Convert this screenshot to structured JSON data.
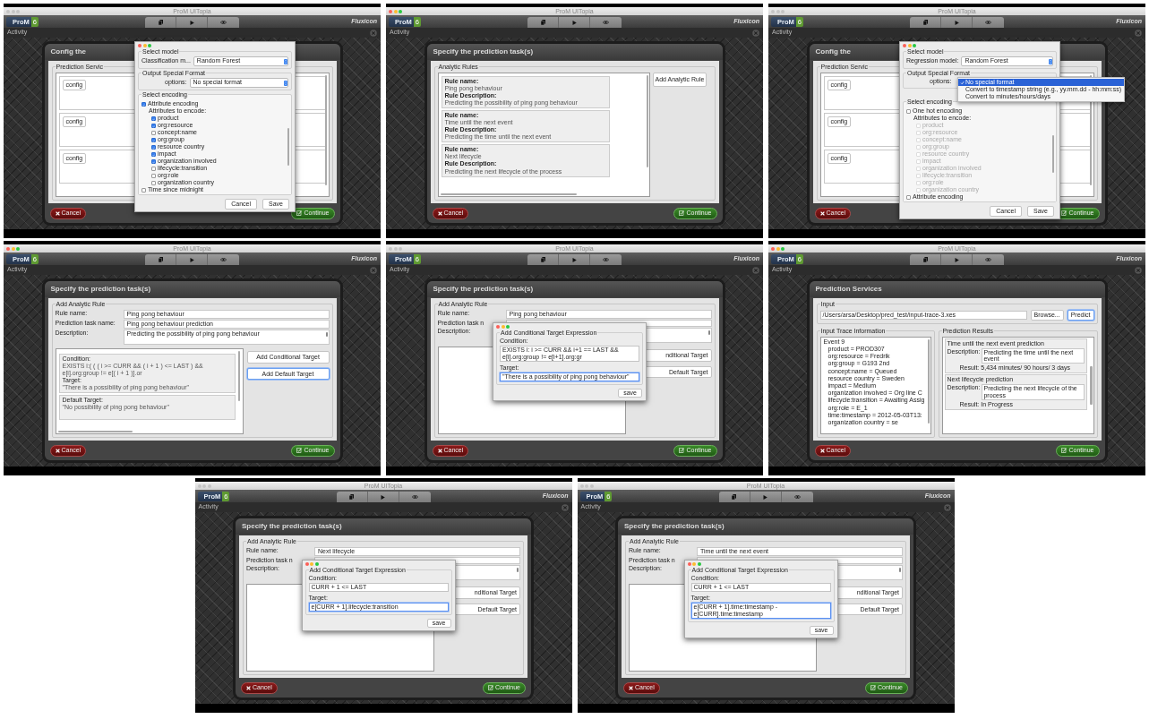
{
  "screens": [
    {
      "kind": "config",
      "window_title": "ProM UITopia",
      "window_focused": false,
      "logo": "ProM",
      "logo_version": "6",
      "brand": "Fluxicon",
      "section": "Activity",
      "dialog_title": "Config the",
      "group_label": "Prediction Servic",
      "config_buttons": [
        "config",
        "config",
        "config"
      ],
      "cancel": "Cancel",
      "continue": "Continue",
      "popup": {
        "kind": "model_config",
        "model_legend": "Select model",
        "model_label": "Classification m...",
        "model_value": "Random Forest",
        "format_legend": "Output Special Format",
        "options_label": "options:",
        "options_value": "No special format",
        "encoding_legend": "Select encoding",
        "encodings": [
          {
            "label": "Attribute encoding",
            "checked": true,
            "attributes_label": "Attributes to encode:",
            "attributes": [
              {
                "label": "product",
                "checked": true,
                "disabled": false
              },
              {
                "label": "org:resource",
                "checked": true,
                "disabled": false
              },
              {
                "label": "concept:name",
                "checked": false,
                "disabled": false
              },
              {
                "label": "org:group",
                "checked": true,
                "disabled": false
              },
              {
                "label": "resource country",
                "checked": true,
                "disabled": false
              },
              {
                "label": "impact",
                "checked": true,
                "disabled": false
              },
              {
                "label": "organization involved",
                "checked": true,
                "disabled": false
              },
              {
                "label": "lifecycle:transition",
                "checked": false,
                "disabled": false
              },
              {
                "label": "org:role",
                "checked": false,
                "disabled": false
              },
              {
                "label": "organization country",
                "checked": false,
                "disabled": false
              }
            ]
          },
          {
            "label": "Time since midnight",
            "checked": false
          }
        ],
        "cancel": "Cancel",
        "save": "Save"
      }
    },
    {
      "kind": "rules",
      "window_title": "ProM UITopia",
      "window_focused": true,
      "logo": "ProM",
      "logo_version": "6",
      "brand": "Fluxicon",
      "section": "Activity",
      "dialog_title": "Specify the prediction task(s)",
      "legend": "Analytic Rules",
      "rules": [
        {
          "name_label": "Rule name:",
          "name": "Ping pong behaviour",
          "description_label": "Rule Description:",
          "description": "Predicting the possibility of ping pong behaviour"
        },
        {
          "name_label": "Rule name:",
          "name": "Time until the next event",
          "description_label": "Rule Description:",
          "description": "Predicting the time until the next event"
        },
        {
          "name_label": "Rule name:",
          "name": "Next lifecycle",
          "description_label": "Rule Description:",
          "description": "Predicting the next lifecycle of the process"
        }
      ],
      "add_button": "Add Analytic Rule",
      "cancel": "Cancel",
      "continue": "Continue"
    },
    {
      "kind": "config",
      "window_title": "ProM UITopia",
      "window_focused": false,
      "logo": "ProM",
      "logo_version": "6",
      "brand": "Fluxicon",
      "section": "Activity",
      "dialog_title": "Config the",
      "group_label": "Prediction Servic",
      "config_buttons": [
        "config",
        "config",
        "config"
      ],
      "cancel": "Cancel",
      "continue": "Continue",
      "popup": {
        "kind": "model_config",
        "model_legend": "Select model",
        "model_label": "Regression model:",
        "model_value": "Random Forest",
        "format_legend": "Output Special Format",
        "options_label": "options:",
        "menu": [
          {
            "label": "No special format",
            "selected": true
          },
          {
            "label": "Convert to timestamp string (e.g., yy.mm.dd - hh:mm:ss)",
            "selected": false
          },
          {
            "label": "Convert to minutes/hours/days",
            "selected": false
          }
        ],
        "encoding_legend": "Select encoding",
        "encodings": [
          {
            "label": "One hot encoding",
            "checked": false,
            "attributes_label": "Attributes to encode:",
            "attributes": [
              {
                "label": "product",
                "checked": false,
                "disabled": true
              },
              {
                "label": "org:resource",
                "checked": false,
                "disabled": true
              },
              {
                "label": "concept:name",
                "checked": false,
                "disabled": true
              },
              {
                "label": "org:group",
                "checked": false,
                "disabled": true
              },
              {
                "label": "resource country",
                "checked": false,
                "disabled": true
              },
              {
                "label": "impact",
                "checked": false,
                "disabled": true
              },
              {
                "label": "organization involved",
                "checked": false,
                "disabled": true
              },
              {
                "label": "lifecycle:transition",
                "checked": false,
                "disabled": true
              },
              {
                "label": "org:role",
                "checked": false,
                "disabled": true
              },
              {
                "label": "organization country",
                "checked": false,
                "disabled": true
              }
            ]
          },
          {
            "label": "Attribute encoding",
            "checked": false
          }
        ],
        "cancel": "Cancel",
        "save": "Save"
      }
    },
    {
      "kind": "rule_editor",
      "window_title": "ProM UITopia",
      "window_focused": true,
      "logo": "ProM",
      "logo_version": "6",
      "brand": "Fluxicon",
      "section": "Activity",
      "dialog_title": "Specify the prediction task(s)",
      "legend": "Add Analytic Rule",
      "fields": [
        {
          "kind": "text",
          "label": "Rule name:",
          "value": "Ping pong behaviour"
        },
        {
          "kind": "text",
          "label": "Prediction task name:",
          "value": "Ping pong behaviour prediction"
        },
        {
          "kind": "textarea",
          "label": "Description:",
          "value": "Predicting the possibility of ping pong behaviour"
        }
      ],
      "targets": [
        {
          "kind": "conditional",
          "condition_label": "Condition:",
          "condition": "EXISTS i:( ( ( i >= CURR && ( i + 1 ) <= LAST ) && e[i].org:group != e[( i + 1 )].or",
          "target_label": "Target:",
          "target": "\"There is a possibility of ping pong behaviour\""
        },
        {
          "kind": "default",
          "label": "Default Target:",
          "target": "\"No possibility of ping pong behaviour\""
        }
      ],
      "buttons": [
        {
          "label": "Add Conditional Target",
          "focused": false
        },
        {
          "label": "Add Default Target",
          "focused": true
        }
      ],
      "cancel": "Cancel",
      "continue": "Continue"
    },
    {
      "kind": "rule_editor",
      "window_title": "ProM UITopia",
      "window_focused": false,
      "logo": "ProM",
      "logo_version": "6",
      "brand": "Fluxicon",
      "section": "Activity",
      "dialog_title": "Specify the prediction task(s)",
      "legend": "Add Analytic Rule",
      "fields": [
        {
          "kind": "text",
          "label": "Rule name:",
          "value": "Ping pong behaviour"
        },
        {
          "kind": "text",
          "label": "Prediction task n"
        },
        {
          "kind": "textarea",
          "label": "Description:"
        }
      ],
      "buttons": [
        {
          "label": "nditional Target",
          "focused": false
        },
        {
          "label": "Default Target",
          "focused": false
        }
      ],
      "cancel": "Cancel",
      "continue": "Continue",
      "popup": {
        "kind": "target_expression",
        "legend": "Add Conditional Target Expression",
        "condition_label": "Condition:",
        "condition": "EXISTS i: i >= CURR && i+1 == LAST && e[i].org:group != e[i+1].org:gr",
        "condition_focused": false,
        "target_label": "Target:",
        "target": "\"There is a possibility of ping pong behaviour\"",
        "target_focused": true,
        "save": "save"
      }
    },
    {
      "kind": "predict",
      "window_title": "ProM UITopia",
      "window_focused": true,
      "logo": "ProM",
      "logo_version": "6",
      "brand": "Fluxicon",
      "section": "Activity",
      "dialog_title": "Prediction Services",
      "input_legend": "Input",
      "path": "/Users/arsa/Desktop/pred_test/input-trace-3.xes",
      "browse": "Browse...",
      "predict": "Predict",
      "trace_legend": "Input Trace Information",
      "event": "Event 9",
      "attributes": [
        "product = PROD307",
        "org:resource = Fredrik",
        "org:group = G193 2nd",
        "concept:name = Queued",
        "resource country = Sweden",
        "impact = Medium",
        "organization involved = Org line C",
        "lifecycle:transition = Awaiting Assig",
        "org:role = E_1",
        "time:timestamp = 2012-05-03T13:",
        "organization country = se"
      ],
      "results_legend": "Prediction Results",
      "results": [
        {
          "title": "Time until the next event prediction",
          "description_label": "Description:",
          "description": "Predicting the time until the next event",
          "result_label": "Result:",
          "result": "5,434 minutes/ 90 hours/ 3 days"
        },
        {
          "title": "Next lifecycle prediction",
          "description_label": "Description:",
          "description": "Predicting the next lifecycle of the process",
          "result_label": "Result:",
          "result": "In Progress"
        }
      ],
      "cancel": "Cancel",
      "continue": "Continue"
    },
    {
      "kind": "rule_editor",
      "window_title": "ProM UITopia",
      "window_focused": false,
      "logo": "ProM",
      "logo_version": "6",
      "brand": "Fluxicon",
      "section": "Activity",
      "dialog_title": "Specify the prediction task(s)",
      "legend": "Add Analytic Rule",
      "fields": [
        {
          "kind": "text",
          "label": "Rule name:",
          "value": "Next lifecycle"
        },
        {
          "kind": "text",
          "label": "Prediction task n"
        },
        {
          "kind": "textarea",
          "label": "Description:"
        }
      ],
      "buttons": [
        {
          "label": "nditional Target",
          "focused": false
        },
        {
          "label": "Default Target",
          "focused": false
        }
      ],
      "cancel": "Cancel",
      "continue": "Continue",
      "popup": {
        "kind": "target_expression",
        "legend": "Add Conditional Target Expression",
        "condition_label": "Condition:",
        "condition": "CURR + 1 <= LAST",
        "condition_focused": false,
        "target_label": "Target:",
        "target": "e[CURR + 1].lifecycle:transition",
        "target_focused": true,
        "save": "save"
      }
    },
    {
      "kind": "rule_editor",
      "window_title": "ProM UITopia",
      "window_focused": false,
      "logo": "ProM",
      "logo_version": "6",
      "brand": "Fluxicon",
      "section": "Activity",
      "dialog_title": "Specify the prediction task(s)",
      "legend": "Add Analytic Rule",
      "fields": [
        {
          "kind": "text",
          "label": "Rule name:",
          "value": "Time until the next event"
        },
        {
          "kind": "text",
          "label": "Prediction task n"
        },
        {
          "kind": "textarea",
          "label": "Description:"
        }
      ],
      "buttons": [
        {
          "label": "nditional Target",
          "focused": false
        },
        {
          "label": "Default Target",
          "focused": false
        }
      ],
      "cancel": "Cancel",
      "continue": "Continue",
      "popup": {
        "kind": "target_expression",
        "legend": "Add Conditional Target Expression",
        "condition_label": "Condition:",
        "condition": "CURR + 1 <= LAST",
        "condition_focused": false,
        "target_label": "Target:",
        "target": "e[CURR + 1].time:timestamp - e[CURR].time:timestamp",
        "target_focused": true,
        "save": "save"
      }
    }
  ]
}
